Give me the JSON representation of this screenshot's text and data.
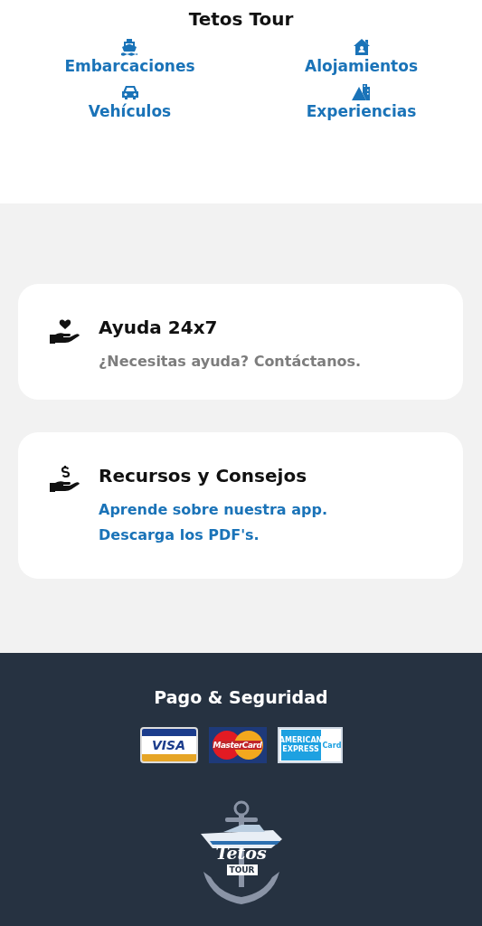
{
  "header": {
    "title": "Tetos Tour"
  },
  "categories": [
    {
      "label": "Embarcaciones",
      "kind": "boat"
    },
    {
      "label": "Alojamientos",
      "kind": "house"
    },
    {
      "label": "Vehículos",
      "kind": "car"
    },
    {
      "label": "Experiencias",
      "kind": "mountain"
    }
  ],
  "cards": [
    {
      "title": "Ayuda 24x7",
      "kind": "help",
      "lines": [
        {
          "text": "¿Necesitas ayuda? Contáctanos.",
          "kind": "muted"
        }
      ]
    },
    {
      "title": "Recursos y Consejos",
      "kind": "money",
      "lines": [
        {
          "text": "Aprende sobre nuestra app.",
          "kind": "link"
        },
        {
          "text": "Descarga los PDF's.",
          "kind": "link"
        }
      ]
    }
  ],
  "footer": {
    "title": "Pago & Seguridad",
    "payment_cards": [
      {
        "kind": "visa",
        "texts": [
          "VISA"
        ]
      },
      {
        "kind": "mastercard",
        "texts": [
          "MasterCard"
        ]
      },
      {
        "kind": "amex",
        "texts": [
          "AMERICAN EXPRESS",
          "Card"
        ]
      }
    ],
    "logo": {
      "texts": [
        "Tetos",
        "TOUR"
      ]
    }
  }
}
